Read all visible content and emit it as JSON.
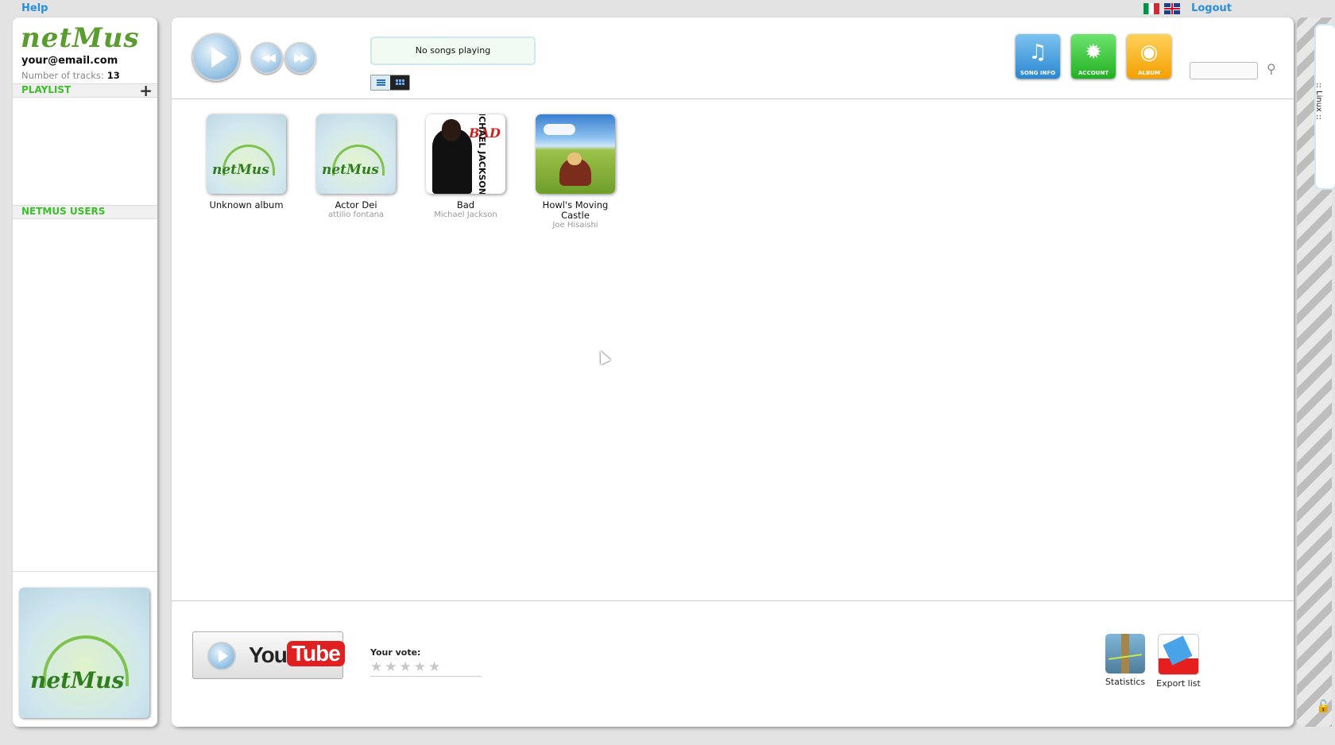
{
  "topbar": {
    "help": "Help",
    "logout": "Logout"
  },
  "sidebar": {
    "logo": "netMus",
    "email": "your@email.com",
    "tracks_label": "Number of tracks:",
    "tracks_count": "13",
    "playlist_label": "PLAYLIST",
    "playlist_add": "+",
    "users_label": "NETMUS USERS",
    "cover_logo": "netMus"
  },
  "player": {
    "status": "No songs playing"
  },
  "toolbar": {
    "song_info": "SONG INFO",
    "account": "ACCOUNT",
    "album": "ALBUM",
    "search_placeholder": ""
  },
  "albums": [
    {
      "title": "Unknown album",
      "artist": "",
      "cover": "netMus"
    },
    {
      "title": "Actor Dei",
      "artist": "attilio fontana",
      "cover": "netMus"
    },
    {
      "title": "Bad",
      "artist": "Michael Jackson",
      "cover_text": "BAD",
      "cover_text2": "MICHAEL JACKSON"
    },
    {
      "title": "Howl's Moving Castle",
      "artist": "Joe Hisaishi"
    }
  ],
  "footer": {
    "youtube_you": "You",
    "youtube_tube": "Tube",
    "vote_label": "Your vote:",
    "rating": 0,
    "statistics": "Statistics",
    "export_list": "Export list"
  },
  "rail": {
    "tab_label": ":: Linux ::"
  }
}
